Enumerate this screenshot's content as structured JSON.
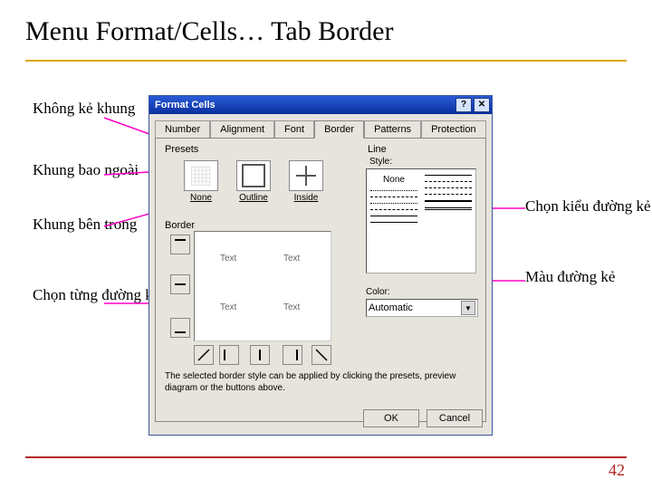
{
  "slide": {
    "title": "Menu Format/Cells… Tab Border",
    "page_number": "42"
  },
  "annotations": {
    "no_border": "Không kẻ khung",
    "outer": "Khung bao ngoài",
    "inner": "Khung bên trong",
    "each_line": "Chọn từng đường kẻ khung",
    "style": "Chọn kiểu đường kẻ",
    "color": "Màu đường kẻ"
  },
  "dialog": {
    "title": "Format Cells",
    "tabs": [
      "Number",
      "Alignment",
      "Font",
      "Border",
      "Patterns",
      "Protection"
    ],
    "active_tab": "Border",
    "groups": {
      "presets": "Presets",
      "border": "Border",
      "line": "Line",
      "style": "Style:",
      "color": "Color:"
    },
    "presets": {
      "none": "None",
      "outline": "Outline",
      "inside": "Inside"
    },
    "preview_text": "Text",
    "color_value": "Automatic",
    "style_none": "None",
    "hint": "The selected border style can be applied by clicking the presets, preview diagram or the buttons above.",
    "buttons": {
      "ok": "OK",
      "cancel": "Cancel"
    }
  }
}
